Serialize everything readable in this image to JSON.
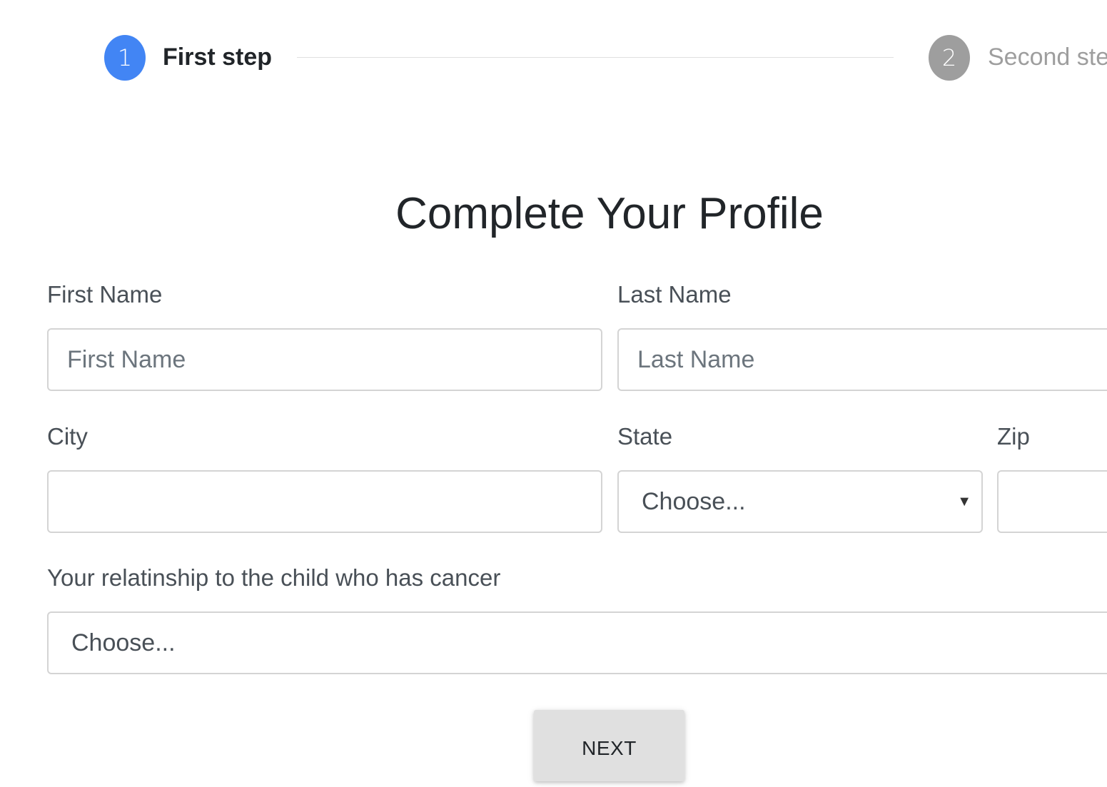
{
  "stepper": {
    "step1": {
      "number": "1",
      "label": "First step",
      "state": "active",
      "color": "#4285f4"
    },
    "step2": {
      "number": "2",
      "label": "Second step",
      "state": "inactive",
      "color": "#9e9e9e"
    }
  },
  "form": {
    "title": "Complete Your Profile",
    "first_name": {
      "label": "First Name",
      "placeholder": "First Name",
      "value": ""
    },
    "last_name": {
      "label": "Last Name",
      "placeholder": "Last Name",
      "value": ""
    },
    "city": {
      "label": "City",
      "value": ""
    },
    "state": {
      "label": "State",
      "selected": "Choose...",
      "caret": "▼"
    },
    "zip": {
      "label": "Zip",
      "value": ""
    },
    "relationship": {
      "label": "Your relatinship to the child who has cancer",
      "selected": "Choose..."
    },
    "next_button": "NEXT"
  }
}
